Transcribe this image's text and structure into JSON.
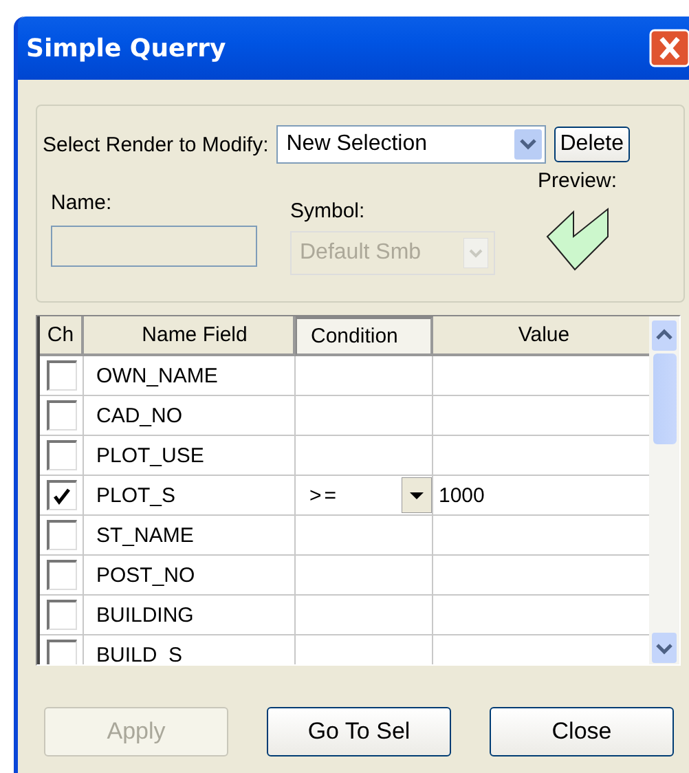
{
  "window": {
    "title": "Simple Querry"
  },
  "render": {
    "label": "Select Render to Modify:",
    "value": "New Selection",
    "delete_button": "Delete"
  },
  "name": {
    "label": "Name:"
  },
  "symbol": {
    "label": "Symbol:",
    "value": "Default Smb",
    "disabled": true
  },
  "preview": {
    "label": "Preview:"
  },
  "table": {
    "columns": [
      "Ch",
      "Name Field",
      "Condition",
      "Value"
    ],
    "rows": [
      {
        "checked": false,
        "name": "OWN_NAME"
      },
      {
        "checked": false,
        "name": "CAD_NO"
      },
      {
        "checked": false,
        "name": "PLOT_USE"
      },
      {
        "checked": true,
        "name": "PLOT_S",
        "condition": ">=",
        "value": "1000"
      },
      {
        "checked": false,
        "name": "ST_NAME"
      },
      {
        "checked": false,
        "name": "POST_NO"
      },
      {
        "checked": false,
        "name": "BUILDING"
      },
      {
        "checked": false,
        "name": "BUILD_S"
      }
    ]
  },
  "buttons": [
    {
      "label": "Apply",
      "disabled": true
    },
    {
      "label": "Go To Sel",
      "disabled": false
    },
    {
      "label": "Close",
      "disabled": false
    }
  ]
}
